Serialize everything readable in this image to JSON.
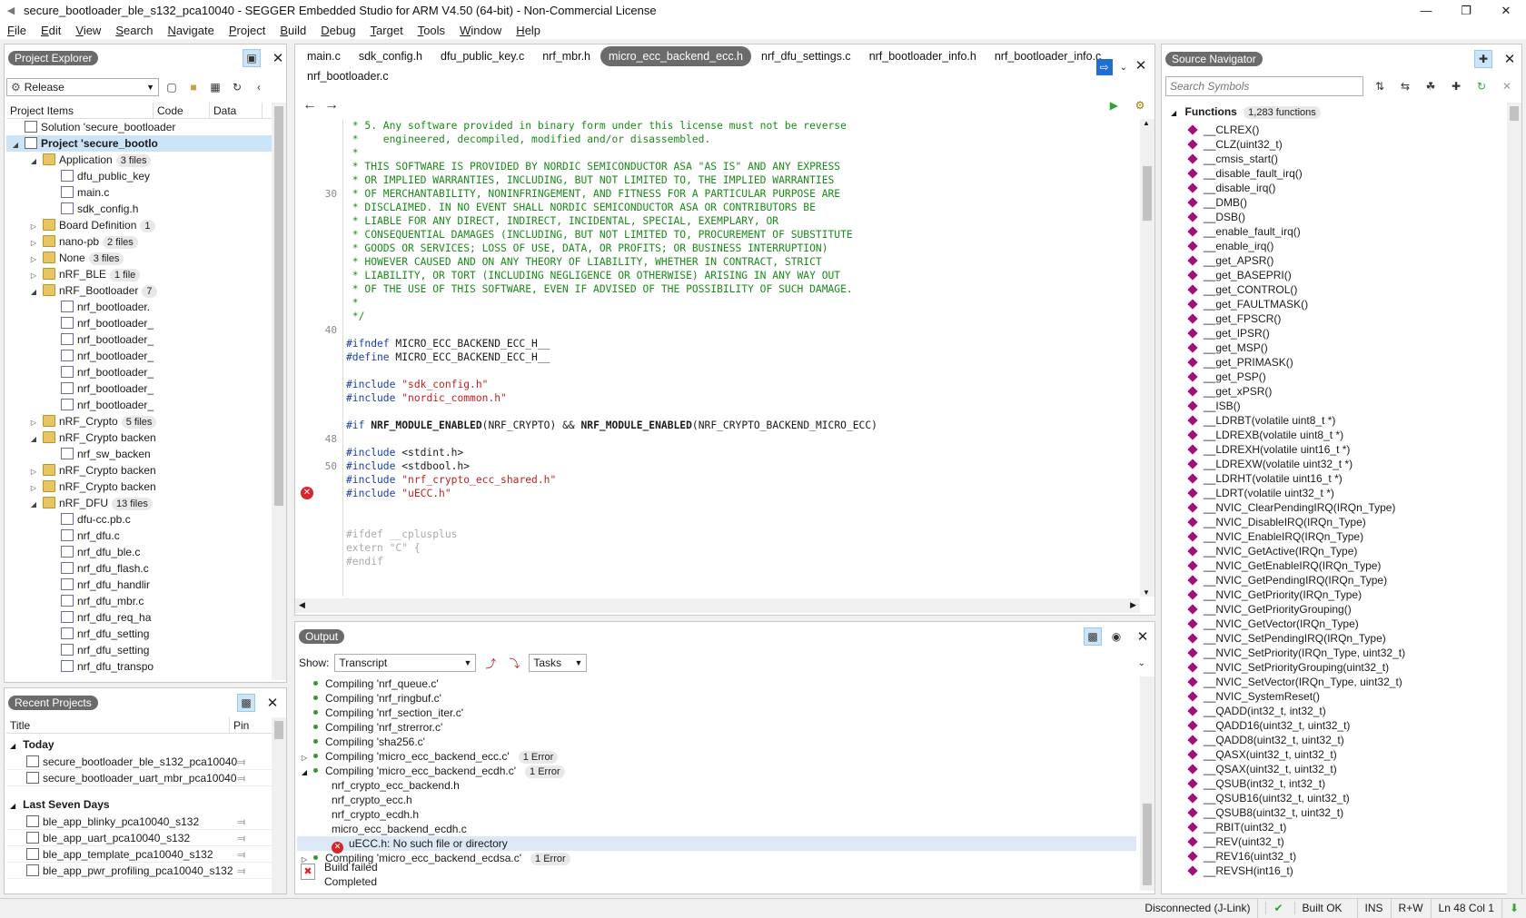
{
  "window": {
    "title": "secure_bootloader_ble_s132_pca10040 - SEGGER Embedded Studio for ARM V4.50 (64-bit) - Non-Commercial License"
  },
  "menu": [
    "File",
    "Edit",
    "View",
    "Search",
    "Navigate",
    "Project",
    "Build",
    "Debug",
    "Target",
    "Tools",
    "Window",
    "Help"
  ],
  "project_explorer": {
    "title": "Project Explorer",
    "config": "Release",
    "columns": [
      "Project Items",
      "Code",
      "Data"
    ],
    "tree": [
      {
        "d": 0,
        "t": "none",
        "icon": "sol",
        "label": "Solution 'secure_bootloader",
        "badge": ""
      },
      {
        "d": 0,
        "t": "open",
        "icon": "sol",
        "label": "Project 'secure_bootlo",
        "badge": "",
        "bold": true,
        "sel": true
      },
      {
        "d": 1,
        "t": "open",
        "icon": "folder",
        "label": "Application",
        "badge": "3 files"
      },
      {
        "d": 2,
        "t": "none",
        "icon": "file",
        "label": "dfu_public_key",
        "badge": ""
      },
      {
        "d": 2,
        "t": "none",
        "icon": "file",
        "label": "main.c",
        "badge": ""
      },
      {
        "d": 2,
        "t": "none",
        "icon": "file",
        "label": "sdk_config.h",
        "badge": ""
      },
      {
        "d": 1,
        "t": "closed",
        "icon": "folder",
        "label": "Board Definition",
        "badge": "1"
      },
      {
        "d": 1,
        "t": "closed",
        "icon": "folder",
        "label": "nano-pb",
        "badge": "2 files"
      },
      {
        "d": 1,
        "t": "closed",
        "icon": "folder",
        "label": "None",
        "badge": "3 files"
      },
      {
        "d": 1,
        "t": "closed",
        "icon": "folder",
        "label": "nRF_BLE",
        "badge": "1 file"
      },
      {
        "d": 1,
        "t": "open",
        "icon": "folder",
        "label": "nRF_Bootloader",
        "badge": "7"
      },
      {
        "d": 2,
        "t": "none",
        "icon": "file",
        "label": "nrf_bootloader.",
        "badge": ""
      },
      {
        "d": 2,
        "t": "none",
        "icon": "file",
        "label": "nrf_bootloader_",
        "badge": ""
      },
      {
        "d": 2,
        "t": "none",
        "icon": "file",
        "label": "nrf_bootloader_",
        "badge": ""
      },
      {
        "d": 2,
        "t": "none",
        "icon": "file",
        "label": "nrf_bootloader_",
        "badge": ""
      },
      {
        "d": 2,
        "t": "none",
        "icon": "file",
        "label": "nrf_bootloader_",
        "badge": ""
      },
      {
        "d": 2,
        "t": "none",
        "icon": "file",
        "label": "nrf_bootloader_",
        "badge": ""
      },
      {
        "d": 2,
        "t": "none",
        "icon": "file",
        "label": "nrf_bootloader_",
        "badge": ""
      },
      {
        "d": 1,
        "t": "closed",
        "icon": "folder",
        "label": "nRF_Crypto",
        "badge": "5 files"
      },
      {
        "d": 1,
        "t": "open",
        "icon": "folder",
        "label": "nRF_Crypto backen",
        "badge": ""
      },
      {
        "d": 2,
        "t": "none",
        "icon": "file",
        "label": "nrf_sw_backen",
        "badge": ""
      },
      {
        "d": 1,
        "t": "closed",
        "icon": "folder",
        "label": "nRF_Crypto backen",
        "badge": ""
      },
      {
        "d": 1,
        "t": "closed",
        "icon": "folder",
        "label": "nRF_Crypto backen",
        "badge": ""
      },
      {
        "d": 1,
        "t": "open",
        "icon": "folder",
        "label": "nRF_DFU",
        "badge": "13 files"
      },
      {
        "d": 2,
        "t": "none",
        "icon": "file",
        "label": "dfu-cc.pb.c",
        "badge": ""
      },
      {
        "d": 2,
        "t": "none",
        "icon": "file",
        "label": "nrf_dfu.c",
        "badge": ""
      },
      {
        "d": 2,
        "t": "none",
        "icon": "file",
        "label": "nrf_dfu_ble.c",
        "badge": ""
      },
      {
        "d": 2,
        "t": "none",
        "icon": "file",
        "label": "nrf_dfu_flash.c",
        "badge": ""
      },
      {
        "d": 2,
        "t": "none",
        "icon": "file",
        "label": "nrf_dfu_handlir",
        "badge": ""
      },
      {
        "d": 2,
        "t": "none",
        "icon": "file",
        "label": "nrf_dfu_mbr.c",
        "badge": ""
      },
      {
        "d": 2,
        "t": "none",
        "icon": "file",
        "label": "nrf_dfu_req_ha",
        "badge": ""
      },
      {
        "d": 2,
        "t": "none",
        "icon": "file",
        "label": "nrf_dfu_setting",
        "badge": ""
      },
      {
        "d": 2,
        "t": "none",
        "icon": "file",
        "label": "nrf_dfu_setting",
        "badge": ""
      },
      {
        "d": 2,
        "t": "none",
        "icon": "file",
        "label": "nrf_dfu_transpo",
        "badge": ""
      }
    ]
  },
  "recent": {
    "title": "Recent Projects",
    "columns": [
      "Title",
      "Pin"
    ],
    "groups": [
      {
        "name": "Today",
        "items": [
          "secure_bootloader_ble_s132_pca10040",
          "secure_bootloader_uart_mbr_pca10040"
        ]
      },
      {
        "name": "Last Seven Days",
        "items": [
          "ble_app_blinky_pca10040_s132",
          "ble_app_uart_pca10040_s132",
          "ble_app_template_pca10040_s132",
          "ble_app_pwr_profiling_pca10040_s132"
        ]
      }
    ]
  },
  "editor": {
    "tabs": [
      "main.c",
      "sdk_config.h",
      "dfu_public_key.c",
      "nrf_mbr.h",
      "micro_ecc_backend_ecc.h",
      "nrf_dfu_settings.c",
      "nrf_bootloader_info.h",
      "nrf_bootloader_info.c",
      "nrf_bootloader.c"
    ],
    "active_tab": "micro_ecc_backend_ecc.h",
    "lines": [
      {
        "n": "",
        "err": false,
        "segs": [
          {
            "c": "cm",
            "t": " * 5. Any software provided in binary form under this license must not be reverse"
          }
        ]
      },
      {
        "n": "",
        "err": false,
        "segs": [
          {
            "c": "cm",
            "t": " *    engineered, decompiled, modified and/or disassembled."
          }
        ]
      },
      {
        "n": "",
        "err": false,
        "segs": [
          {
            "c": "cm",
            "t": " *"
          }
        ]
      },
      {
        "n": "",
        "err": false,
        "segs": [
          {
            "c": "cm",
            "t": " * THIS SOFTWARE IS PROVIDED BY NORDIC SEMICONDUCTOR ASA \"AS IS\" AND ANY EXPRESS"
          }
        ]
      },
      {
        "n": "",
        "err": false,
        "segs": [
          {
            "c": "cm",
            "t": " * OR IMPLIED WARRANTIES, INCLUDING, BUT NOT LIMITED TO, THE IMPLIED WARRANTIES"
          }
        ]
      },
      {
        "n": "30",
        "err": false,
        "segs": [
          {
            "c": "cm",
            "t": " * OF MERCHANTABILITY, NONINFRINGEMENT, AND FITNESS FOR A PARTICULAR PURPOSE ARE"
          }
        ]
      },
      {
        "n": "",
        "err": false,
        "segs": [
          {
            "c": "cm",
            "t": " * DISCLAIMED. IN NO EVENT SHALL NORDIC SEMICONDUCTOR ASA OR CONTRIBUTORS BE"
          }
        ]
      },
      {
        "n": "",
        "err": false,
        "segs": [
          {
            "c": "cm",
            "t": " * LIABLE FOR ANY DIRECT, INDIRECT, INCIDENTAL, SPECIAL, EXEMPLARY, OR"
          }
        ]
      },
      {
        "n": "",
        "err": false,
        "segs": [
          {
            "c": "cm",
            "t": " * CONSEQUENTIAL DAMAGES (INCLUDING, BUT NOT LIMITED TO, PROCUREMENT OF SUBSTITUTE"
          }
        ]
      },
      {
        "n": "",
        "err": false,
        "segs": [
          {
            "c": "cm",
            "t": " * GOODS OR SERVICES; LOSS OF USE, DATA, OR PROFITS; OR BUSINESS INTERRUPTION)"
          }
        ]
      },
      {
        "n": "",
        "err": false,
        "segs": [
          {
            "c": "cm",
            "t": " * HOWEVER CAUSED AND ON ANY THEORY OF LIABILITY, WHETHER IN CONTRACT, STRICT"
          }
        ]
      },
      {
        "n": "",
        "err": false,
        "segs": [
          {
            "c": "cm",
            "t": " * LIABILITY, OR TORT (INCLUDING NEGLIGENCE OR OTHERWISE) ARISING IN ANY WAY OUT"
          }
        ]
      },
      {
        "n": "",
        "err": false,
        "segs": [
          {
            "c": "cm",
            "t": " * OF THE USE OF THIS SOFTWARE, EVEN IF ADVISED OF THE POSSIBILITY OF SUCH DAMAGE."
          }
        ]
      },
      {
        "n": "",
        "err": false,
        "segs": [
          {
            "c": "cm",
            "t": " *"
          }
        ]
      },
      {
        "n": "",
        "err": false,
        "segs": [
          {
            "c": "cm",
            "t": " */"
          }
        ]
      },
      {
        "n": "40",
        "err": false,
        "segs": []
      },
      {
        "n": "",
        "err": false,
        "segs": [
          {
            "c": "kw",
            "t": "#ifndef"
          },
          {
            "c": "",
            "t": " MICRO_ECC_BACKEND_ECC_H__"
          }
        ]
      },
      {
        "n": "",
        "err": false,
        "segs": [
          {
            "c": "kw",
            "t": "#define"
          },
          {
            "c": "",
            "t": " MICRO_ECC_BACKEND_ECC_H__"
          }
        ]
      },
      {
        "n": "",
        "err": false,
        "segs": []
      },
      {
        "n": "",
        "err": false,
        "segs": [
          {
            "c": "kw",
            "t": "#include"
          },
          {
            "c": "",
            "t": " "
          },
          {
            "c": "str",
            "t": "\"sdk_config.h\""
          }
        ]
      },
      {
        "n": "",
        "err": false,
        "segs": [
          {
            "c": "kw",
            "t": "#include"
          },
          {
            "c": "",
            "t": " "
          },
          {
            "c": "str",
            "t": "\"nordic_common.h\""
          }
        ]
      },
      {
        "n": "",
        "err": false,
        "segs": []
      },
      {
        "n": "",
        "err": false,
        "segs": [
          {
            "c": "kw",
            "t": "#if"
          },
          {
            "c": "",
            "t": " "
          },
          {
            "c": "bold",
            "t": "NRF_MODULE_ENABLED"
          },
          {
            "c": "",
            "t": "(NRF_CRYPTO) && "
          },
          {
            "c": "bold",
            "t": "NRF_MODULE_ENABLED"
          },
          {
            "c": "",
            "t": "(NRF_CRYPTO_BACKEND_MICRO_ECC)"
          }
        ]
      },
      {
        "n": "48",
        "err": false,
        "segs": []
      },
      {
        "n": "",
        "err": false,
        "segs": [
          {
            "c": "kw",
            "t": "#include"
          },
          {
            "c": "",
            "t": " <stdint.h>"
          }
        ]
      },
      {
        "n": "50",
        "err": false,
        "segs": [
          {
            "c": "kw",
            "t": "#include"
          },
          {
            "c": "",
            "t": " <stdbool.h>"
          }
        ]
      },
      {
        "n": "",
        "err": false,
        "segs": [
          {
            "c": "kw",
            "t": "#include"
          },
          {
            "c": "",
            "t": " "
          },
          {
            "c": "str",
            "t": "\"nrf_crypto_ecc_shared.h\""
          }
        ]
      },
      {
        "n": "",
        "err": true,
        "segs": [
          {
            "c": "kw",
            "t": "#include"
          },
          {
            "c": "",
            "t": " "
          },
          {
            "c": "str",
            "t": "\"uECC.h\""
          }
        ]
      },
      {
        "n": "",
        "err": false,
        "segs": []
      },
      {
        "n": "",
        "err": false,
        "segs": []
      },
      {
        "n": "",
        "err": false,
        "segs": [
          {
            "c": "dim",
            "t": "#ifdef __cplusplus"
          }
        ]
      },
      {
        "n": "",
        "err": false,
        "segs": [
          {
            "c": "dim",
            "t": "extern \"C\" {"
          }
        ]
      },
      {
        "n": "",
        "err": false,
        "segs": [
          {
            "c": "dim",
            "t": "#endif"
          }
        ]
      }
    ]
  },
  "output": {
    "title": "Output",
    "show_label": "Show:",
    "show_value": "Transcript",
    "tasks": "Tasks",
    "lines": [
      {
        "k": "ok",
        "t": "Compiling 'nrf_queue.c'",
        "e": ""
      },
      {
        "k": "ok",
        "t": "Compiling 'nrf_ringbuf.c'",
        "e": ""
      },
      {
        "k": "ok",
        "t": "Compiling 'nrf_section_iter.c'",
        "e": ""
      },
      {
        "k": "ok",
        "t": "Compiling 'nrf_strerror.c'",
        "e": ""
      },
      {
        "k": "ok",
        "t": "Compiling 'sha256.c'",
        "e": ""
      },
      {
        "k": "ok-c",
        "t": "Compiling 'micro_ecc_backend_ecc.c'",
        "e": "1 Error"
      },
      {
        "k": "ok-o",
        "t": "Compiling 'micro_ecc_backend_ecdh.c'",
        "e": "1 Error"
      },
      {
        "k": "sub",
        "t": "nrf_crypto_ecc_backend.h",
        "e": ""
      },
      {
        "k": "sub",
        "t": "nrf_crypto_ecc.h",
        "e": ""
      },
      {
        "k": "sub",
        "t": "nrf_crypto_ecdh.h",
        "e": ""
      },
      {
        "k": "sub",
        "t": "micro_ecc_backend_ecdh.c",
        "e": ""
      },
      {
        "k": "err",
        "t": "uECC.h: No such file or directory",
        "e": ""
      },
      {
        "k": "ok-c",
        "t": "Compiling 'micro_ecc_backend_ecdsa.c'",
        "e": "1 Error"
      }
    ],
    "build_status": "Build failed",
    "completed": "Completed"
  },
  "navigator": {
    "title": "Source Navigator",
    "search_placeholder": "Search Symbols",
    "group": "Functions",
    "count": "1,283 functions",
    "functions": [
      "__CLREX()",
      "__CLZ(uint32_t)",
      "__cmsis_start()",
      "__disable_fault_irq()",
      "__disable_irq()",
      "__DMB()",
      "__DSB()",
      "__enable_fault_irq()",
      "__enable_irq()",
      "__get_APSR()",
      "__get_BASEPRI()",
      "__get_CONTROL()",
      "__get_FAULTMASK()",
      "__get_FPSCR()",
      "__get_IPSR()",
      "__get_MSP()",
      "__get_PRIMASK()",
      "__get_PSP()",
      "__get_xPSR()",
      "__ISB()",
      "__LDRBT(volatile uint8_t *)",
      "__LDREXB(volatile uint8_t *)",
      "__LDREXH(volatile uint16_t *)",
      "__LDREXW(volatile uint32_t *)",
      "__LDRHT(volatile uint16_t *)",
      "__LDRT(volatile uint32_t *)",
      "__NVIC_ClearPendingIRQ(IRQn_Type)",
      "__NVIC_DisableIRQ(IRQn_Type)",
      "__NVIC_EnableIRQ(IRQn_Type)",
      "__NVIC_GetActive(IRQn_Type)",
      "__NVIC_GetEnableIRQ(IRQn_Type)",
      "__NVIC_GetPendingIRQ(IRQn_Type)",
      "__NVIC_GetPriority(IRQn_Type)",
      "__NVIC_GetPriorityGrouping()",
      "__NVIC_GetVector(IRQn_Type)",
      "__NVIC_SetPendingIRQ(IRQn_Type)",
      "__NVIC_SetPriority(IRQn_Type, uint32_t)",
      "__NVIC_SetPriorityGrouping(uint32_t)",
      "__NVIC_SetVector(IRQn_Type, uint32_t)",
      "__NVIC_SystemReset()",
      "__QADD(int32_t, int32_t)",
      "__QADD16(uint32_t, uint32_t)",
      "__QADD8(uint32_t, uint32_t)",
      "__QASX(uint32_t, uint32_t)",
      "__QSAX(uint32_t, uint32_t)",
      "__QSUB(int32_t, int32_t)",
      "__QSUB16(uint32_t, uint32_t)",
      "__QSUB8(uint32_t, uint32_t)",
      "__RBIT(uint32_t)",
      "__REV(uint32_t)",
      "__REV16(uint32_t)",
      "__REVSH(int16_t)"
    ]
  },
  "status": {
    "connection": "Disconnected (J-Link)",
    "build": "Built OK",
    "ins": "INS",
    "rw": "R+W",
    "pos": "Ln 48 Col 1"
  }
}
